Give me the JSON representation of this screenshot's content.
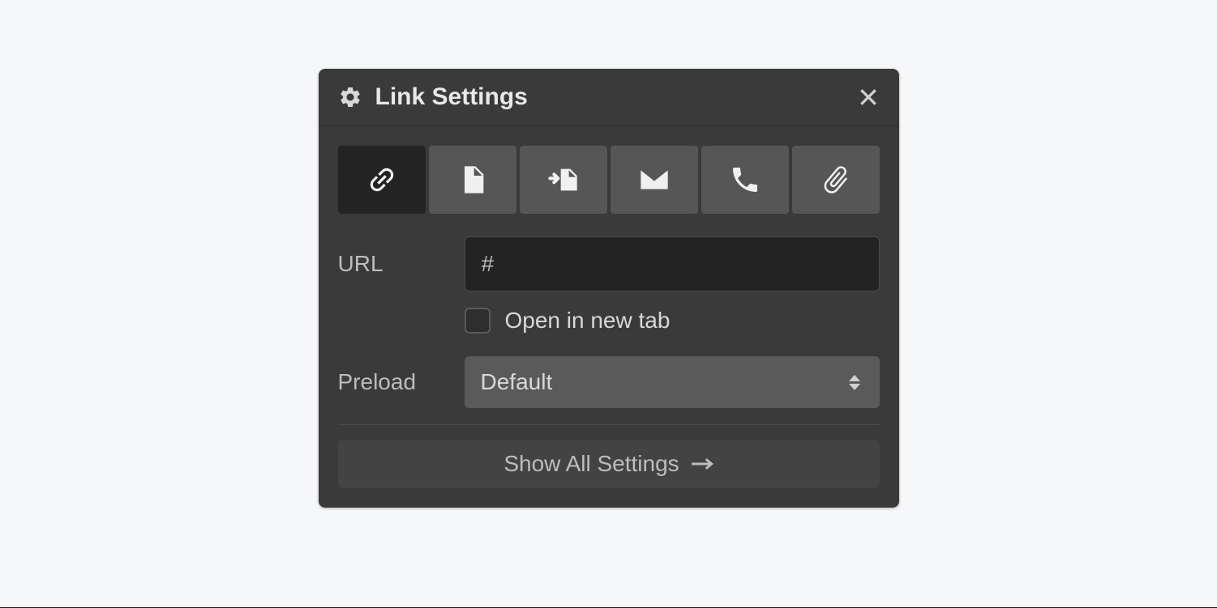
{
  "panel": {
    "title": "Link Settings"
  },
  "tabs": {
    "link": "link-icon",
    "page": "page-icon",
    "section": "section-icon",
    "email": "email-icon",
    "phone": "phone-icon",
    "file": "file-icon"
  },
  "fields": {
    "url_label": "URL",
    "url_value": "#",
    "open_new_tab_label": "Open in new tab",
    "open_new_tab_checked": false,
    "preload_label": "Preload",
    "preload_value": "Default"
  },
  "footer": {
    "show_all_label": "Show All Settings"
  }
}
